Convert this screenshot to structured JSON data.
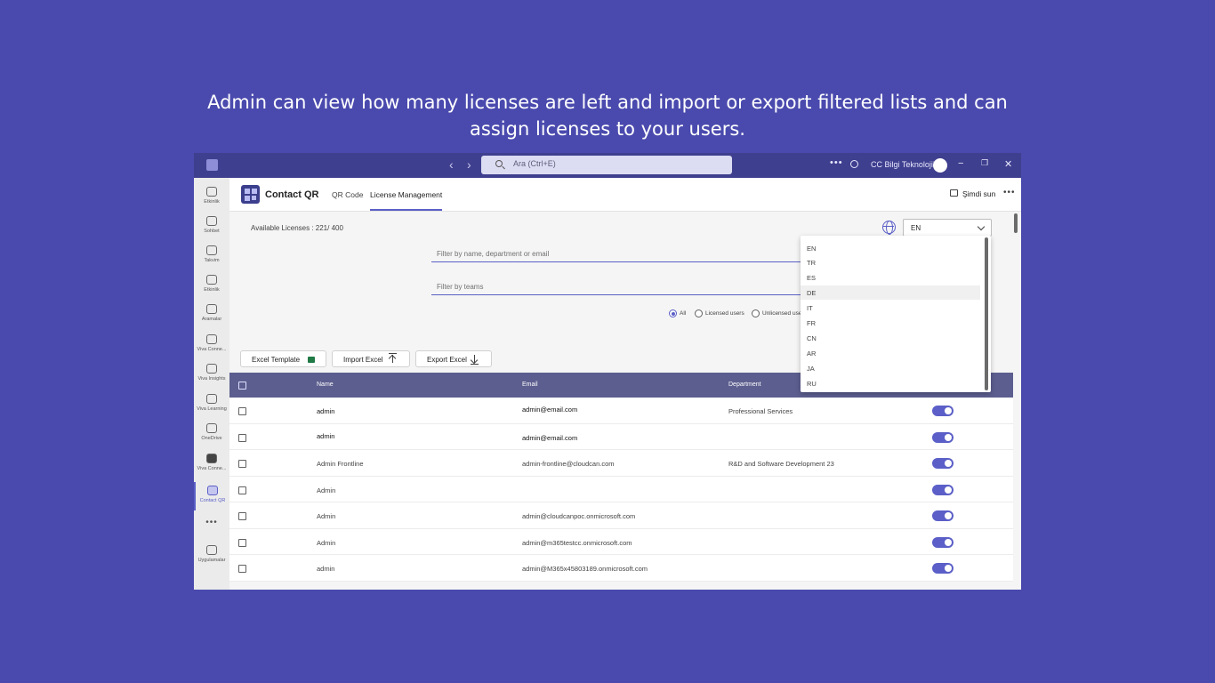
{
  "headline": {
    "line1": "Admin can view how many licenses are left and import or export filtered lists and can",
    "line2": "assign licenses to your users."
  },
  "titlebar": {
    "search_placeholder": "Ara (Ctrl+E)",
    "org_name": "CC Bilgi Teknolojileri",
    "nav_back": "‹",
    "nav_forward": "›",
    "minimize": "−",
    "maximize": "❐",
    "close": "✕"
  },
  "rail": {
    "items": [
      {
        "label": "Etkinlik"
      },
      {
        "label": "Sohbet"
      },
      {
        "label": "Takvim"
      },
      {
        "label": "Etkinlik"
      },
      {
        "label": "Aramalar"
      },
      {
        "label": "Viva Conne..."
      },
      {
        "label": "Viva Insights"
      },
      {
        "label": "Viva Learning"
      },
      {
        "label": "OneDrive"
      },
      {
        "label": "Viva Conne..."
      },
      {
        "label": "Contact QR"
      },
      {
        "label": "Uygulamalar"
      }
    ],
    "more": "•••"
  },
  "app": {
    "name": "Contact QR",
    "tabs": [
      {
        "label": "QR Code"
      },
      {
        "label": "License Management"
      }
    ],
    "present_label": "Şimdi sun",
    "more": "•••"
  },
  "licenses": {
    "text": "Available Licenses : 221/ 400"
  },
  "language": {
    "selected": "EN",
    "options": [
      "EN",
      "TR",
      "ES",
      "DE",
      "IT",
      "FR",
      "CN",
      "AR",
      "JA",
      "RU"
    ],
    "highlighted": "DE"
  },
  "filters": {
    "name_placeholder": "Filter by name, department or email",
    "teams_placeholder": "Filter by teams"
  },
  "radios": {
    "all": "All",
    "licensed": "Licensed users",
    "unlicensed": "Unlicensed use"
  },
  "buttons": {
    "excel_template": "Excel Template",
    "import_excel": "Import Excel",
    "export_excel": "Export Excel"
  },
  "table": {
    "columns": {
      "name": "Name",
      "email": "Email",
      "department": "Department"
    },
    "rows": [
      {
        "name": "admin",
        "email": "admin@email.com",
        "department": "Professional Services"
      },
      {
        "name": "admin",
        "email": "admin@email.com",
        "department": ""
      },
      {
        "name": "Admin Frontline",
        "email": "admin-frontline@cloudcan.com",
        "department": "R&D and Software Development 23"
      },
      {
        "name": "Admin",
        "email": "",
        "department": ""
      },
      {
        "name": "Admin",
        "email": "admin@cloudcanpoc.onmicrosoft.com",
        "department": ""
      },
      {
        "name": "Admin",
        "email": "admin@m365testcc.onmicrosoft.com",
        "department": ""
      },
      {
        "name": "admin",
        "email": "admin@M365x45803189.onmicrosoft.com",
        "department": ""
      }
    ]
  },
  "colors": {
    "background": "#4a4aae",
    "accent": "#5b5fc7",
    "titlebar": "#3f3f8f",
    "table_header": "#5c5e8f"
  }
}
